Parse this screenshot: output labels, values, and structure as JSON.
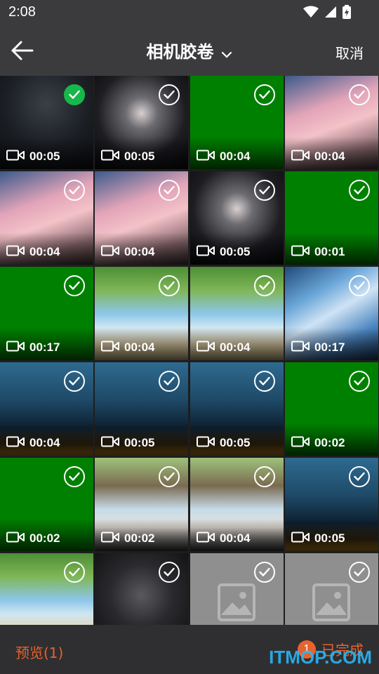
{
  "status": {
    "time": "2:08"
  },
  "header": {
    "title": "相机胶卷",
    "cancel": "取消"
  },
  "tiles": [
    {
      "duration": "00:05",
      "thumb": "man-portrait",
      "selected": true
    },
    {
      "duration": "00:05",
      "thumb": "anime-girl-helmet",
      "selected": false
    },
    {
      "duration": "00:04",
      "thumb": "green-screen",
      "selected": false
    },
    {
      "duration": "00:04",
      "thumb": "anime-girl-pink",
      "selected": false
    },
    {
      "duration": "00:04",
      "thumb": "anime-girl-pink",
      "selected": false
    },
    {
      "duration": "00:04",
      "thumb": "anime-girl-pink",
      "selected": false
    },
    {
      "duration": "00:05",
      "thumb": "anime-girl-helmet",
      "selected": false
    },
    {
      "duration": "00:01",
      "thumb": "green-screen",
      "selected": false
    },
    {
      "duration": "00:17",
      "thumb": "green-screen",
      "selected": false
    },
    {
      "duration": "00:04",
      "thumb": "beach-tree",
      "selected": false
    },
    {
      "duration": "00:04",
      "thumb": "beach-tree",
      "selected": false
    },
    {
      "duration": "00:17",
      "thumb": "blue-sky-art",
      "selected": false
    },
    {
      "duration": "00:04",
      "thumb": "night-forest",
      "selected": false
    },
    {
      "duration": "00:05",
      "thumb": "night-forest",
      "selected": false
    },
    {
      "duration": "00:05",
      "thumb": "night-forest",
      "selected": false
    },
    {
      "duration": "00:02",
      "thumb": "green-screen",
      "selected": false
    },
    {
      "duration": "00:02",
      "thumb": "green-screen",
      "selected": false
    },
    {
      "duration": "00:02",
      "thumb": "dog-beach",
      "selected": false
    },
    {
      "duration": "00:04",
      "thumb": "dog-beach",
      "selected": false
    },
    {
      "duration": "00:05",
      "thumb": "night-forest",
      "selected": false
    },
    {
      "duration": "",
      "thumb": "beach-tree",
      "selected": false
    },
    {
      "duration": "",
      "thumb": "dark-figure",
      "selected": false
    },
    {
      "duration": "",
      "thumb": "placeholder-image",
      "selected": false
    },
    {
      "duration": "",
      "thumb": "placeholder-image",
      "selected": false
    }
  ],
  "footer": {
    "preview": "预览(1)",
    "count": "1",
    "done": "已完成"
  },
  "watermark": "ITMOP.COM",
  "colors": {
    "accent": "#e8622f",
    "check": "#18b74a",
    "green": "#008000"
  }
}
